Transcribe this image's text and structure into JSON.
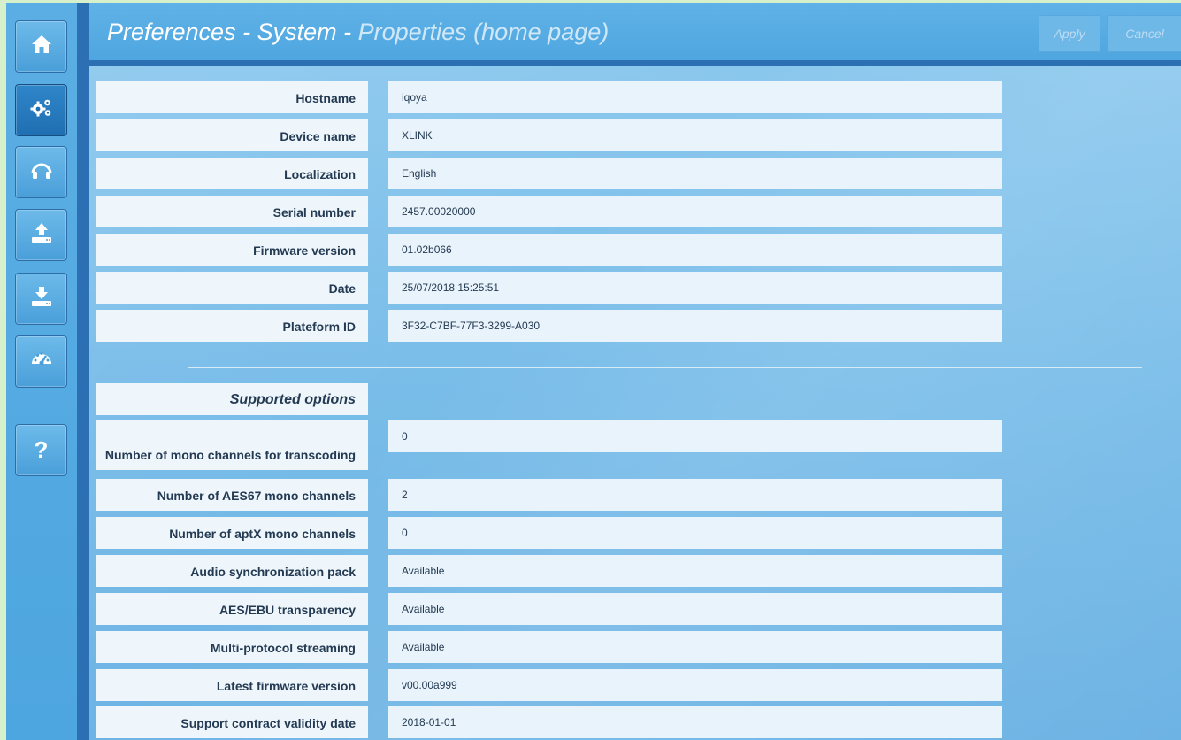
{
  "header": {
    "title_main": "Preferences - System - ",
    "title_sub": "Properties (home page)",
    "apply_label": "Apply",
    "cancel_label": "Cancel"
  },
  "sidebar": {
    "items": [
      {
        "icon": "home-icon"
      },
      {
        "icon": "gears-icon",
        "active": true
      },
      {
        "icon": "headphones-icon"
      },
      {
        "icon": "upload-icon"
      },
      {
        "icon": "download-icon"
      },
      {
        "icon": "speedometer-icon"
      },
      {
        "icon": "help-icon",
        "label": "?"
      }
    ]
  },
  "properties": [
    {
      "label": "Hostname",
      "value": "iqoya"
    },
    {
      "label": "Device name",
      "value": "XLINK"
    },
    {
      "label": "Localization",
      "value": "English"
    },
    {
      "label": "Serial number",
      "value": "2457.00020000"
    },
    {
      "label": "Firmware version",
      "value": "01.02b066"
    },
    {
      "label": "Date",
      "value": "25/07/2018 15:25:51"
    },
    {
      "label": "Plateform ID",
      "value": "3F32-C7BF-77F3-3299-A030"
    }
  ],
  "options_title": "Supported options",
  "options": [
    {
      "label": "Number of mono channels for transcoding",
      "value": "0"
    },
    {
      "label": "Number of AES67 mono channels",
      "value": "2"
    },
    {
      "label": "Number of aptX mono channels",
      "value": "0"
    },
    {
      "label": "Audio synchronization pack",
      "value": "Available"
    },
    {
      "label": "AES/EBU transparency",
      "value": "Available"
    },
    {
      "label": "Multi-protocol streaming",
      "value": "Available"
    },
    {
      "label": "Latest firmware version",
      "value": "v00.00a999"
    },
    {
      "label": "Support contract validity date",
      "value": "2018-01-01"
    }
  ]
}
